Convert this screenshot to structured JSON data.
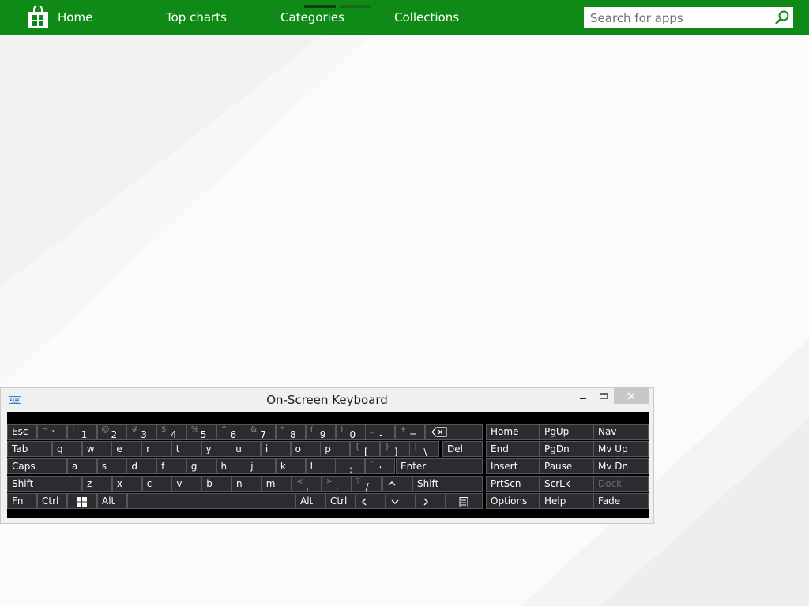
{
  "store": {
    "nav": [
      {
        "label": "Home"
      },
      {
        "label": "Top charts"
      },
      {
        "label": "Categories"
      },
      {
        "label": "Collections"
      }
    ],
    "search": {
      "placeholder": "Search for apps",
      "value": ""
    },
    "accent": "#0f8a16"
  },
  "osk": {
    "title": "On-Screen Keyboard",
    "rows": {
      "r1": {
        "esc": "Esc",
        "digits": [
          {
            "shift": "~",
            "main": "`"
          },
          {
            "shift": "!",
            "main": "1"
          },
          {
            "shift": "@",
            "main": "2"
          },
          {
            "shift": "#",
            "main": "3"
          },
          {
            "shift": "$",
            "main": "4"
          },
          {
            "shift": "%",
            "main": "5"
          },
          {
            "shift": "^",
            "main": "6"
          },
          {
            "shift": "&",
            "main": "7"
          },
          {
            "shift": "*",
            "main": "8"
          },
          {
            "shift": "(",
            "main": "9"
          },
          {
            "shift": ")",
            "main": "0"
          },
          {
            "shift": "_",
            "main": "-"
          },
          {
            "shift": "+",
            "main": "="
          }
        ]
      },
      "r2": {
        "tab": "Tab",
        "letters": [
          "q",
          "w",
          "e",
          "r",
          "t",
          "y",
          "u",
          "i",
          "o",
          "p"
        ],
        "sym": [
          {
            "shift": "{",
            "main": "["
          },
          {
            "shift": "}",
            "main": "]"
          },
          {
            "shift": "|",
            "main": "\\"
          }
        ],
        "del": "Del"
      },
      "r3": {
        "caps": "Caps",
        "letters": [
          "a",
          "s",
          "d",
          "f",
          "g",
          "h",
          "j",
          "k",
          "l"
        ],
        "sym": [
          {
            "shift": ":",
            "main": ";"
          },
          {
            "shift": "\"",
            "main": "'"
          }
        ],
        "enter": "Enter"
      },
      "r4": {
        "shift_left": "Shift",
        "letters": [
          "z",
          "x",
          "c",
          "v",
          "b",
          "n",
          "m"
        ],
        "sym": [
          {
            "shift": "<",
            "main": ","
          },
          {
            "shift": ">",
            "main": "."
          },
          {
            "shift": "?",
            "main": "/"
          }
        ],
        "up": "^",
        "shift_right": "Shift"
      },
      "r5": {
        "fn": "Fn",
        "ctrl_left": "Ctrl",
        "alt_left": "Alt",
        "alt_right": "Alt",
        "ctrl_right": "Ctrl",
        "left": "<",
        "down": "v",
        "right": ">"
      }
    },
    "nav_keys": [
      [
        "Home",
        "PgUp",
        "Nav"
      ],
      [
        "End",
        "PgDn",
        "Mv Up"
      ],
      [
        "Insert",
        "Pause",
        "Mv Dn"
      ],
      [
        "PrtScn",
        "ScrLk",
        "Dock"
      ],
      [
        "Options",
        "Help",
        "Fade"
      ]
    ]
  }
}
